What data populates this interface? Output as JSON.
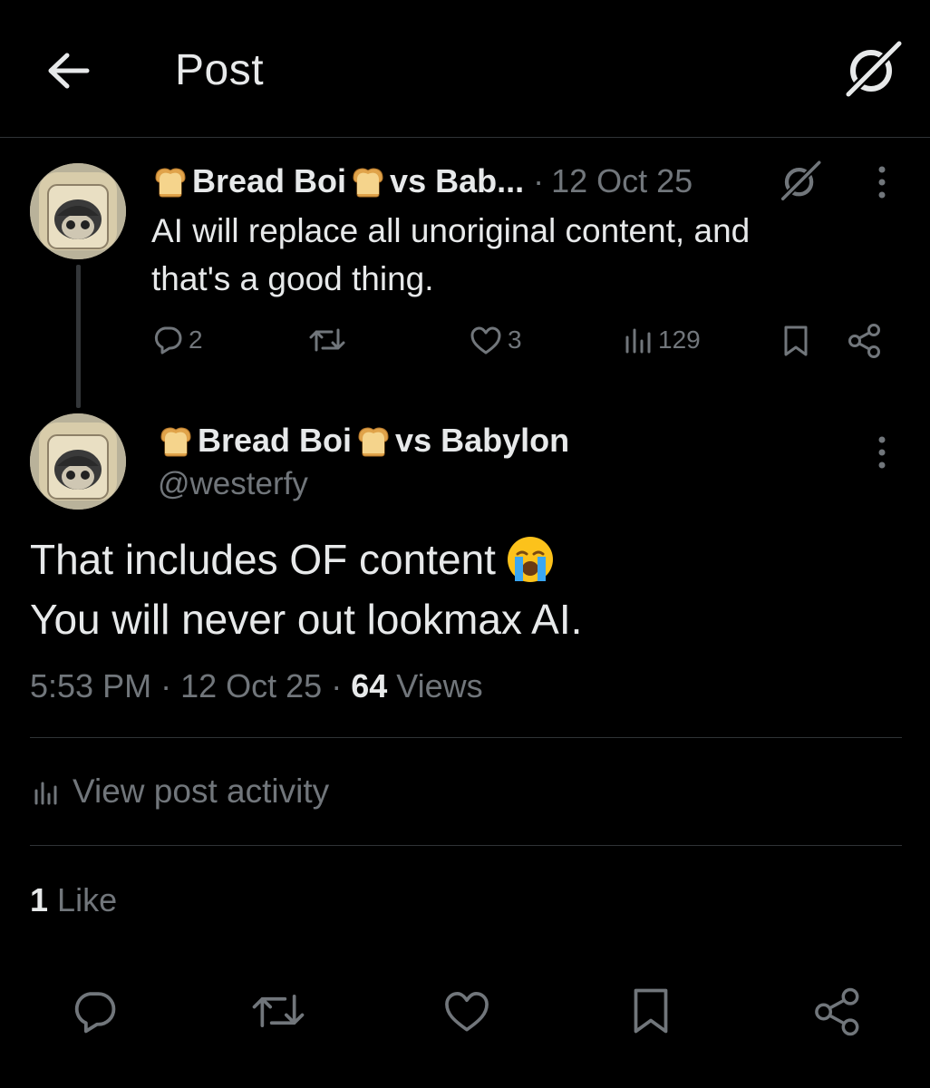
{
  "header": {
    "title": "Post"
  },
  "parent_post": {
    "display_name": "Bread Boi",
    "name_suffix": "vs Bab...",
    "separator": "·",
    "date": "12 Oct 25",
    "text_line1": "AI will replace all unoriginal content, and",
    "text_line2": "that's a good thing.",
    "actions": {
      "replies": "2",
      "likes": "3",
      "views": "129"
    }
  },
  "main_post": {
    "display_name": "Bread Boi",
    "name_suffix": "vs Babylon",
    "handle": "@westerfy",
    "text_line1": "That includes OF content",
    "text_line2": "You will never out lookmax AI.",
    "time": "5:53 PM",
    "sep1": "·",
    "date": "12 Oct 25",
    "sep2": "·",
    "views_count": "64",
    "views_label": "Views",
    "post_activity": "View post activity",
    "likes_count": "1",
    "likes_label": "Like"
  },
  "icons": {
    "back": "arrow-left-icon",
    "grok": "grok-icon",
    "more": "more-vertical-icon",
    "reply": "reply-icon",
    "repost": "repost-icon",
    "like": "heart-icon",
    "views": "views-icon",
    "bookmark": "bookmark-icon",
    "share": "share-icon",
    "emoji": "crying-face-emoji"
  },
  "colors": {
    "background": "#000000",
    "text": "#e7e9ea",
    "muted": "#71767b",
    "divider": "#2f3336"
  }
}
